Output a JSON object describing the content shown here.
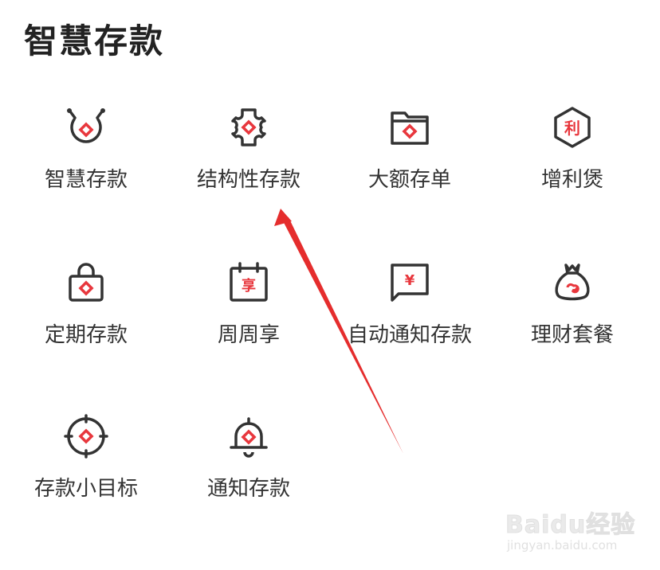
{
  "section": {
    "title": "智慧存款"
  },
  "colors": {
    "icon_stroke": "#333333",
    "accent_red": "#e8373d",
    "arrow_red": "#e52d2d",
    "watermark_gray": "#cccccc"
  },
  "items": [
    {
      "label": "智慧存款",
      "icon": "smart-deposit-icon"
    },
    {
      "label": "结构性存款",
      "icon": "puzzle-gear-icon"
    },
    {
      "label": "大额存单",
      "icon": "folder-icon"
    },
    {
      "label": "增利煲",
      "icon": "hexagon-li-icon",
      "icon_text": "利"
    },
    {
      "label": "定期存款",
      "icon": "lock-bag-icon"
    },
    {
      "label": "周周享",
      "icon": "calendar-icon",
      "icon_text": "享"
    },
    {
      "label": "自动通知存款",
      "icon": "chat-yen-icon",
      "icon_text": "¥"
    },
    {
      "label": "理财套餐",
      "icon": "money-bag-icon"
    },
    {
      "label": "存款小目标",
      "icon": "target-icon"
    },
    {
      "label": "通知存款",
      "icon": "bell-icon"
    }
  ],
  "watermark": {
    "brand": "Baidu经验",
    "url": "jingyan.baidu.com"
  }
}
